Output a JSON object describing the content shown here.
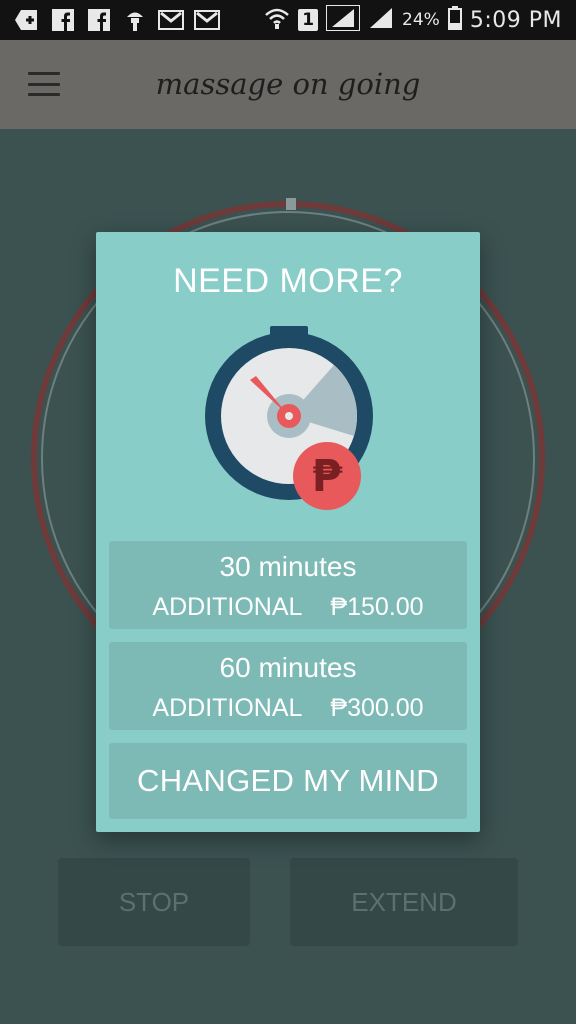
{
  "status_bar": {
    "left_icons": [
      "add-icon",
      "facebook-icon",
      "facebook-icon",
      "lamp-icon",
      "gmail-icon",
      "gmail-icon"
    ],
    "sim_label": "1",
    "battery_percent": "24%",
    "time": "5:09 PM"
  },
  "app_bar": {
    "title": "massage on going"
  },
  "background": {
    "stop_label": "STOP",
    "extend_label": "EXTEND"
  },
  "dialog": {
    "title": "NEED MORE?",
    "options": [
      {
        "minutes": "30 minutes",
        "additional": "ADDITIONAL",
        "price": "₱150.00"
      },
      {
        "minutes": "60 minutes",
        "additional": "ADDITIONAL",
        "price": "₱300.00"
      }
    ],
    "cancel_label": "CHANGED MY MIND",
    "peso_symbol": "₱"
  },
  "colors": {
    "dialog_bg": "#89cdc9",
    "option_bg": "#7dbab6",
    "ring_red": "#6e3a3a",
    "peso_badge": "#e8595c",
    "timer_dark": "#1e4a66"
  }
}
